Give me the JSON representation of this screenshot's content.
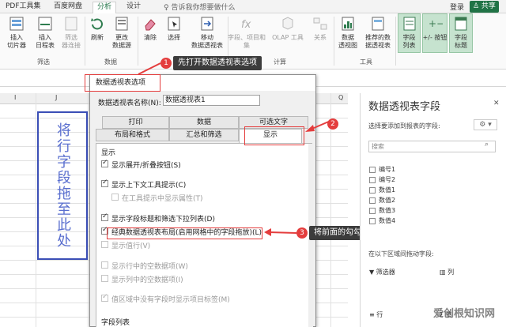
{
  "tabs": {
    "pdf": "PDF工具集",
    "baidu": "百度网盘",
    "analyze": "分析",
    "design": "设计",
    "tellme": "♀ 告诉我你想要做什么",
    "login": "登录",
    "share": "♙ 共享"
  },
  "ribbon": {
    "insert_slicer": "插入\n切片器",
    "insert_timeline": "插入\n日程表",
    "filter_conn": "筛选\n器连接",
    "refresh": "刷新",
    "change_source": "更改\n数据源",
    "clear": "清除",
    "select": "选择",
    "move": "移动\n数据透视表",
    "fields_items": "字段、项目和\n集",
    "olap": "OLAP 工具",
    "relations": "关系",
    "pivot_chart": "数据\n透视图",
    "recommended": "推荐的数\n据透视表",
    "field_list": "字段\n列表",
    "plus_minus": "+/- 按钮",
    "field_headers": "字段\n标题",
    "grp_filter": "筛选",
    "grp_data": "数据",
    "grp_calc": "计算",
    "grp_tools": "工具"
  },
  "columns": [
    "I",
    "J",
    "Q"
  ],
  "sheet_text": "将行字段拖至此处",
  "dialog": {
    "title": "数据透视表选项",
    "name_label": "数据透视表名称(N):",
    "name_value": "数据透视表1",
    "tabs": {
      "print": "打印",
      "data": "数据",
      "alt_text": "可选文字",
      "layout": "布局和格式",
      "totals": "汇总和筛选",
      "display": "显示"
    },
    "section_display": "显示",
    "options": [
      {
        "label": "显示展开/折叠按钮(S)",
        "checked": true,
        "enabled": true
      },
      {
        "label": "显示上下文工具提示(C)",
        "checked": true,
        "enabled": true
      },
      {
        "label": "在工具提示中显示属性(T)",
        "checked": false,
        "enabled": false
      },
      {
        "label": "显示字段标题和筛选下拉列表(D)",
        "checked": true,
        "enabled": true
      },
      {
        "label": "经典数据透视表布局(启用网格中的字段拖放)(L)",
        "checked": true,
        "enabled": true
      },
      {
        "label": "显示值行(V)",
        "checked": false,
        "enabled": false
      },
      {
        "label": "显示行中的空数据项(W)",
        "checked": false,
        "enabled": false
      },
      {
        "label": "显示列中的空数据项(I)",
        "checked": false,
        "enabled": false
      },
      {
        "label": "值区域中没有字段时显示项目标签(M)",
        "checked": true,
        "enabled": false
      }
    ],
    "section_fields": "字段列表"
  },
  "callouts": {
    "one_num": "1",
    "one_text": "先打开数据透视表选项",
    "two_num": "2",
    "three_num": "3",
    "three_text": "将前面的勾勾去掉"
  },
  "pane": {
    "title": "数据透视表字段",
    "close": "✕",
    "subtitle": "选择要添加到报表的字段:",
    "gear": "⚙ ▾",
    "search": "搜索",
    "fields": [
      "编号1",
      "编号2",
      "数值1",
      "数值2",
      "数值3",
      "数值4"
    ],
    "drag_title": "在以下区域间拖动字段:",
    "filter": "▼ 筛选器",
    "columns": "▥ 列",
    "rows": "≡ 行",
    "values": "Σ 值"
  },
  "watermark": "爱创根知识网",
  "colors": {
    "accent": "#217346",
    "callout_red": "#e43d3d",
    "vtext_blue": "#5a6fcf"
  }
}
